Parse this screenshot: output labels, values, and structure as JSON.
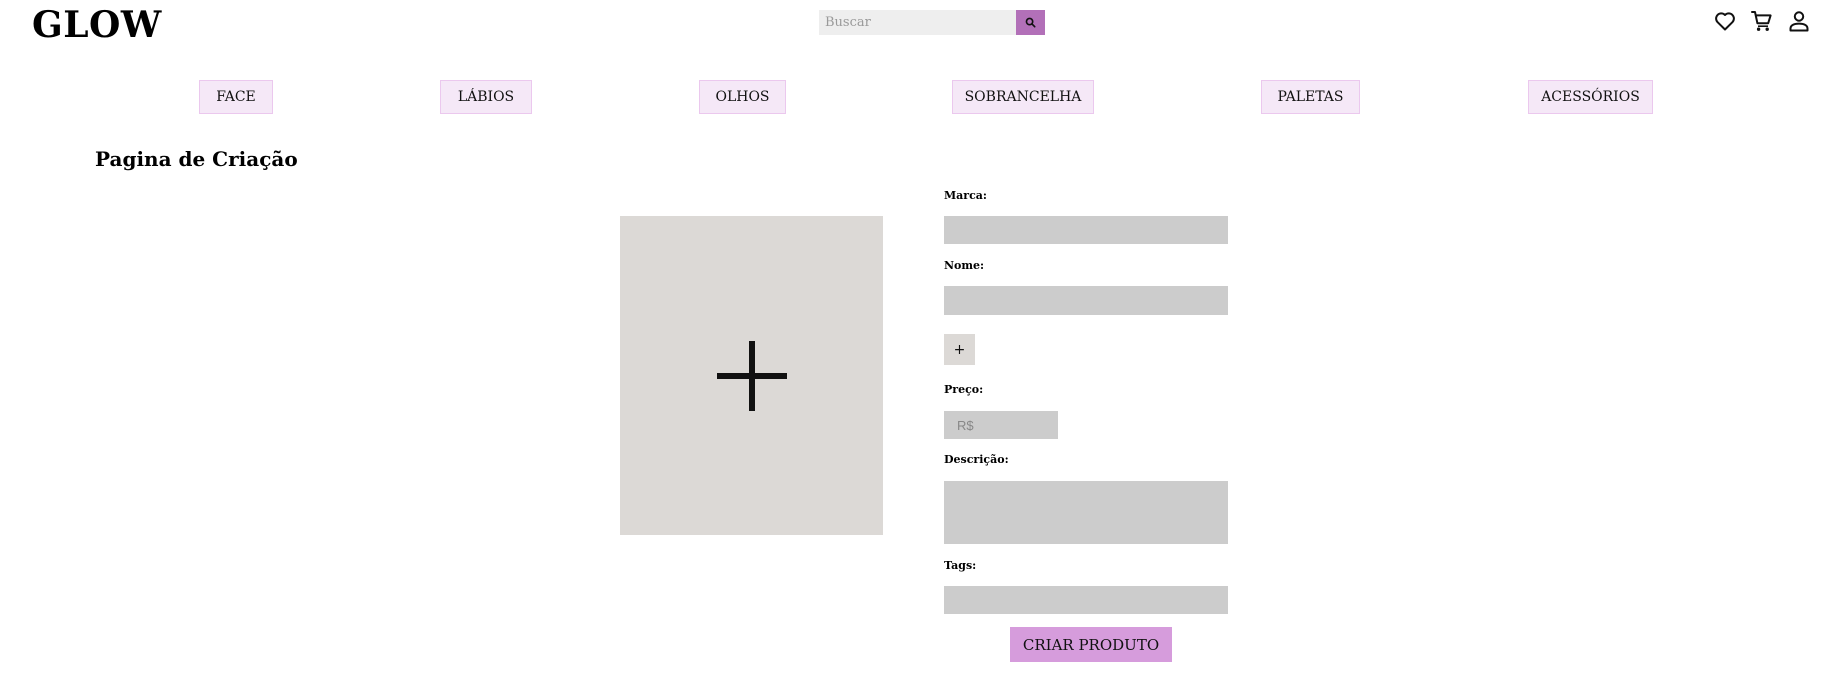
{
  "header": {
    "logo": "GLOW",
    "search": {
      "placeholder": "Buscar",
      "value": "",
      "icon": "search-icon"
    },
    "icons": [
      "heart-icon",
      "cart-icon",
      "user-icon"
    ]
  },
  "nav": {
    "items": [
      {
        "label": "FACE"
      },
      {
        "label": "LÁBIOS"
      },
      {
        "label": "OLHOS"
      },
      {
        "label": "SOBRANCELHA"
      },
      {
        "label": "PALETAS"
      },
      {
        "label": "ACESSÓRIOS"
      }
    ]
  },
  "page": {
    "title": "Pagina de Criação"
  },
  "upload": {
    "icon": "plus-icon"
  },
  "form": {
    "brand_label": "Marca:",
    "brand_value": "",
    "name_label": "Nome:",
    "name_value": "",
    "add_button": "+",
    "price_label": "Preço:",
    "price_placeholder": "R$",
    "price_value": "",
    "description_label": "Descrição:",
    "description_value": "",
    "tags_label": "Tags:",
    "tags_value": "",
    "submit": "CRIAR PRODUTO"
  },
  "colors": {
    "accent": "#b270b8",
    "nav_background": "#f5e8f7",
    "nav_border": "#ebc8ee",
    "button_background": "#d69cdc",
    "upload_background": "#dcd9d6",
    "field_background": "#cccccc",
    "search_background": "#eeeeee"
  }
}
